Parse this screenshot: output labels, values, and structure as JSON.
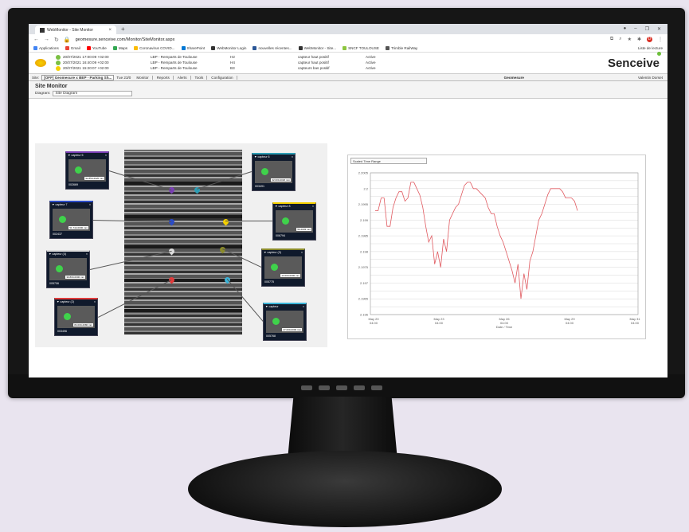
{
  "browser": {
    "tab_title": "WebMonitor - Site Monitor",
    "url": "geomesure.senceive.com/Monitor/SiteMonitor.aspx",
    "bookmarks": [
      {
        "label": "Applications",
        "color": "#4285f4"
      },
      {
        "label": "Gmail",
        "color": "#ea4335"
      },
      {
        "label": "YouTube",
        "color": "#ff0000"
      },
      {
        "label": "Maps",
        "color": "#34a853"
      },
      {
        "label": "Coronavirus COVID...",
        "color": "#fbbc05"
      },
      {
        "label": "SharePoint",
        "color": "#0078d4"
      },
      {
        "label": "WebMonitor Login",
        "color": "#333333"
      },
      {
        "label": "nouvelles récentes...",
        "color": "#2b5797"
      },
      {
        "label": "WebMonitor - Site...",
        "color": "#333333"
      },
      {
        "label": "SNCF TOULOUSE",
        "color": "#8dc63f"
      },
      {
        "label": "Trimble RailWay",
        "color": "#555555"
      }
    ],
    "reading_list": "Liste de lecture"
  },
  "alerts": [
    {
      "datetime": "20/07/2021 17:00:09 +02:00",
      "place": "LBP - Remparts de Toulouse",
      "sensor": "H2",
      "status": "capteur haut positif",
      "state": "Active",
      "color": "#7bc043"
    },
    {
      "datetime": "20/07/2021 16:40:09 +02:00",
      "place": "LBP - Remparts de Toulouse",
      "sensor": "H4",
      "status": "capteur haut positif",
      "state": "Active",
      "color": "#7bc043"
    },
    {
      "datetime": "20/07/2021 15:20:07 +02:00",
      "place": "LBP - Remparts de Toulouse",
      "sensor": "B3",
      "status": "capteurs bas positif",
      "state": "Active",
      "color": "#f5d000"
    }
  ],
  "brand": "Senceive",
  "sitebar": {
    "site_label": "Site:",
    "site_value": "[OFF] Geomesure x BEP - Parking Sh...",
    "time": "Tue 23/0",
    "menu": [
      "Monitor",
      "Reports",
      "Alerts",
      "Tools",
      "Configuration"
    ],
    "geomesure": "Geomesure",
    "user": "Valentin Dorset"
  },
  "page": {
    "title": "Site Monitor",
    "diagram_label": "Diagram:",
    "diagram_value": "Site Diagram"
  },
  "cameras": [
    {
      "name": "capteur 5",
      "id": "002669",
      "reading": "92.850-2020 mm"
    },
    {
      "name": "capteur 6",
      "id": "003491",
      "reading": "32.000-2020 mm"
    },
    {
      "name": "capteur 7",
      "id": "002437",
      "reading": "51.742-0000 mm"
    },
    {
      "name": "capteur 8",
      "id": "006794",
      "reading": "56.2003 mm"
    },
    {
      "name": "capteur (4)",
      "id": "005706",
      "reading": "30.800-0000 mm"
    },
    {
      "name": "capteur (3)",
      "id": "005775",
      "reading": "13.000-0000 mm"
    },
    {
      "name": "capteur (2)",
      "id": "003496",
      "reading": "84.000-2080 mm"
    },
    {
      "name": "capteur",
      "id": "005768",
      "reading": "27.000-0000 mm"
    }
  ],
  "chart_select": "Scaled Time Range",
  "chart_data": {
    "type": "line",
    "xlabel": "Date / Time",
    "x_ticks": [
      "May 20 04:00",
      "May 23 04:00",
      "May 26 04:00",
      "May 29 04:00",
      "May 31 04:00"
    ],
    "y_ticks": [
      "2.2005",
      "2.2",
      "2.1995",
      "2.199",
      "2.1985",
      "2.198",
      "2.1975",
      "2.197",
      "2.1965",
      "2.196"
    ],
    "ylim": [
      2.196,
      2.2005
    ],
    "color": "#e05a60",
    "series": [
      {
        "values": [
          2.1993,
          2.1993,
          2.1997,
          2.1997,
          2.1988,
          2.1988,
          2.1994,
          2.1997,
          2.1999,
          2.1999,
          2.1996,
          2.1997,
          2.2002,
          2.2002,
          2.2,
          2.1998,
          2.1994,
          2.1988,
          2.1983,
          2.1985,
          2.1976,
          2.198,
          2.1975,
          2.1984,
          2.198,
          2.199,
          2.1992,
          2.1994,
          2.1995,
          2.1998,
          2.2001,
          2.2002,
          2.2002,
          2.2,
          2.2,
          2.1999,
          2.1998,
          2.1997,
          2.1994,
          2.1992,
          2.1992,
          2.1988,
          2.1985,
          2.1983,
          2.198,
          2.1977,
          2.1974,
          2.197,
          2.1976,
          2.1965,
          2.1973,
          2.1968,
          2.1977,
          2.198,
          2.1985,
          2.199,
          2.1992,
          2.1995,
          2.1998,
          2.2,
          2.2,
          2.2,
          2.2,
          2.1999,
          2.1997,
          2.1997,
          2.1997,
          2.1996,
          2.1993
        ]
      }
    ]
  }
}
